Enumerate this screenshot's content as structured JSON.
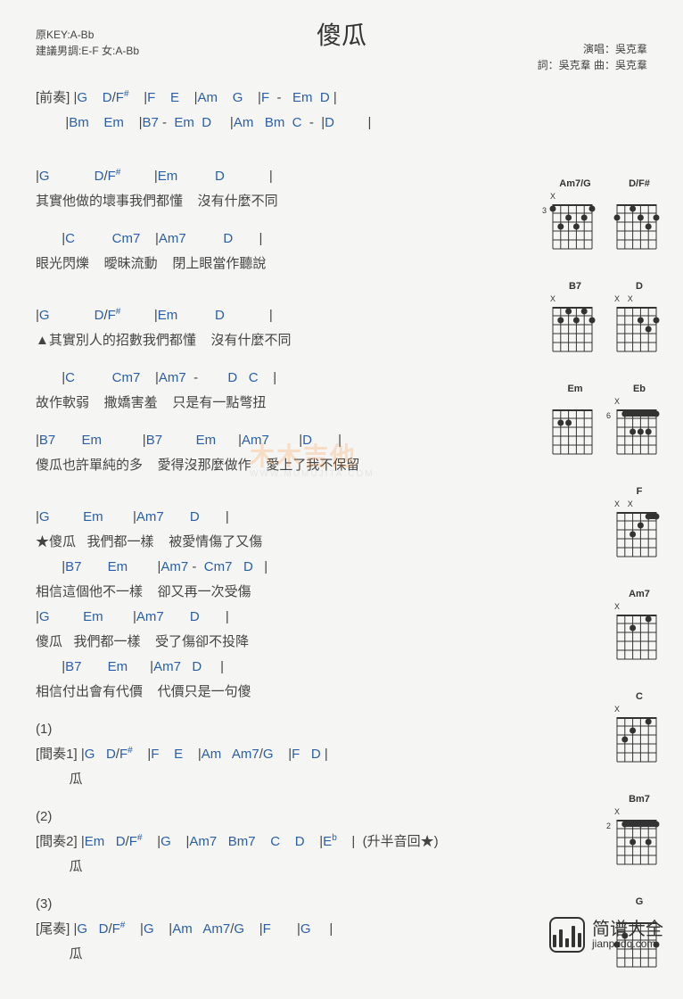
{
  "title": "傻瓜",
  "meta_left": {
    "line1": "原KEY:A-Bb",
    "line2": "建議男調:E-F 女:A-Bb"
  },
  "meta_right": {
    "performer_label": "演唱：",
    "performer": "吳克羣",
    "lyricist_label": "詞：",
    "lyricist": "吳克羣",
    "composer_label": "曲：",
    "composer": "吳克羣"
  },
  "sections": {
    "intro_label": "[前奏]",
    "intro_l1": "|G    D/F#    |F    E    |Am    G    |F  -   Em  D |",
    "intro_l2": "|Bm    Em    |B7 -  Em  D     |Am   Bm  C  -  |D         |",
    "verse1_c1": "|G            D/F#         |Em          D            |",
    "verse1_l1": "其實他做的壞事我們都懂    沒有什麼不同",
    "verse1_c2": "       |C          Cm7    |Am7          D       |",
    "verse1_l2": "眼光閃爍    曖昧流動    閉上眼當作聽說",
    "verse2_mark": "▲",
    "verse2_c1": "|G            D/F#         |Em          D            |",
    "verse2_l1": "其實別人的招數我們都懂    沒有什麼不同",
    "verse2_c2": "       |C          Cm7    |Am7  -        D   C    |",
    "verse2_l2": "故作軟弱    撒嬌害羞    只是有一點彆扭",
    "pre_c1": "|B7       Em           |B7         Em      |Am7        |D       |",
    "pre_l1": "傻瓜也許單純的多    愛得沒那麼做作    愛上了我不保留",
    "chorus_mark": "★",
    "chorus_c1": "|G         Em        |Am7       D       |",
    "chorus_l1": "傻瓜   我們都一樣    被愛情傷了又傷",
    "chorus_c2": "       |B7       Em        |Am7 -  Cm7   D   |",
    "chorus_l2": "相信這個他不一樣    卻又再一次受傷",
    "chorus_c3": "|G         Em        |Am7       D       |",
    "chorus_l3": "傻瓜   我們都一樣    受了傷卻不投降",
    "chorus_c4": "       |B7       Em      |Am7   D     |",
    "chorus_l4": "相信付出會有代價    代價只是一句傻",
    "marker1": "(1)",
    "interlude1_label": "[間奏1]",
    "interlude1_c": "|G   D/F#    |F    E    |Am   Am7/G    |F   D |",
    "interlude1_l": "瓜",
    "marker2": "(2)",
    "interlude2_label": "[間奏2]",
    "interlude2_c": "|Em   D/F#    |G    |Am7   Bm7    C    D    |Eb    |  (升半音回★)",
    "interlude2_l": "瓜",
    "marker3": "(3)",
    "outro_label": "[尾奏]",
    "outro_c": "|G   D/F#    |G    |Am   Am7/G    |F       |G     |",
    "outro_l": "瓜"
  },
  "chord_diagrams": [
    {
      "row": [
        {
          "name": "Am7/G",
          "marks": [
            "X",
            "",
            "",
            "",
            "",
            ""
          ],
          "fretNum": "3",
          "dots": [
            [
              0,
              0
            ],
            [
              2,
              1
            ],
            [
              1,
              2
            ],
            [
              2,
              3
            ],
            [
              1,
              4
            ],
            [
              0,
              5
            ]
          ]
        },
        {
          "name": "D/F#",
          "marks": [
            "",
            "",
            "",
            "",
            "",
            ""
          ],
          "fretNum": "",
          "dots": [
            [
              1,
              0
            ],
            [
              0,
              2
            ],
            [
              1,
              3
            ],
            [
              2,
              4
            ],
            [
              1,
              5
            ]
          ]
        }
      ]
    },
    {
      "row": [
        {
          "name": "B7",
          "marks": [
            "X",
            "",
            "",
            "",
            "",
            ""
          ],
          "fretNum": "",
          "dots": [
            [
              1,
              1
            ],
            [
              0,
              2
            ],
            [
              1,
              3
            ],
            [
              0,
              4
            ],
            [
              1,
              5
            ]
          ]
        },
        {
          "name": "D",
          "marks": [
            "X",
            "X",
            "",
            "",
            "",
            ""
          ],
          "fretNum": "",
          "dots": [
            [
              1,
              3
            ],
            [
              2,
              4
            ],
            [
              1,
              5
            ]
          ]
        }
      ]
    },
    {
      "row": [
        {
          "name": "Em",
          "marks": [
            "",
            "",
            "",
            "",
            "",
            ""
          ],
          "fretNum": "",
          "dots": [
            [
              1,
              1
            ],
            [
              1,
              2
            ]
          ]
        },
        {
          "name": "Eb",
          "marks": [
            "X",
            "",
            "",
            "",
            "",
            ""
          ],
          "fretNum": "6",
          "dots": [
            [
              0,
              1
            ],
            [
              2,
              2
            ],
            [
              2,
              3
            ],
            [
              2,
              4
            ],
            [
              0,
              5
            ]
          ],
          "barre": [
            0,
            1,
            5
          ]
        }
      ]
    },
    {
      "row": [
        {
          "name": "F",
          "marks": [
            "X",
            "X",
            "",
            "",
            "",
            ""
          ],
          "fretNum": "",
          "dots": [
            [
              2,
              2
            ],
            [
              1,
              3
            ],
            [
              0,
              4
            ],
            [
              0,
              5
            ]
          ],
          "barre": [
            0,
            4,
            5
          ]
        }
      ]
    },
    {
      "row": [
        {
          "name": "Am7",
          "marks": [
            "X",
            "",
            "",
            "",
            "",
            ""
          ],
          "fretNum": "",
          "dots": [
            [
              1,
              2
            ],
            [
              0,
              4
            ]
          ]
        }
      ]
    },
    {
      "row": [
        {
          "name": "C",
          "marks": [
            "X",
            "",
            "",
            "",
            "",
            ""
          ],
          "fretNum": "",
          "dots": [
            [
              2,
              1
            ],
            [
              1,
              2
            ],
            [
              0,
              4
            ]
          ]
        }
      ]
    },
    {
      "row": [
        {
          "name": "Bm7",
          "marks": [
            "X",
            "",
            "",
            "",
            "",
            ""
          ],
          "fretNum": "2",
          "dots": [
            [
              0,
              1
            ],
            [
              2,
              2
            ],
            [
              0,
              3
            ],
            [
              2,
              4
            ],
            [
              0,
              5
            ]
          ],
          "barre": [
            0,
            1,
            5
          ]
        }
      ]
    },
    {
      "row": [
        {
          "name": "G",
          "marks": [
            "",
            "",
            "",
            "",
            "",
            ""
          ],
          "fretNum": "",
          "dots": [
            [
              2,
              0
            ],
            [
              1,
              1
            ],
            [
              2,
              5
            ]
          ]
        }
      ]
    }
  ],
  "watermark": {
    "top": "木木吉他",
    "bottom": "WWW.MUMUJITA.COM"
  },
  "footer": {
    "cn": "简谱大全",
    "url": "jianpudq.com"
  }
}
